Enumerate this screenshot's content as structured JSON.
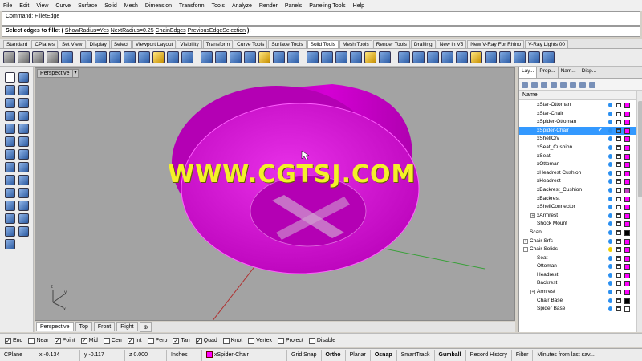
{
  "menu": [
    "File",
    "Edit",
    "View",
    "Curve",
    "Surface",
    "Solid",
    "Mesh",
    "Dimension",
    "Transform",
    "Tools",
    "Analyze",
    "Render",
    "Panels",
    "Paneling Tools",
    "Help"
  ],
  "command_history": "Command: FilletEdge",
  "command_prompt": {
    "prefix": "Select edges to fillet (",
    "opt1": "ShowRadius=Yes",
    "opt2": "NextRadius=0.25",
    "opt3": "ChainEdges",
    "opt4": "PreviousEdgeSelection",
    "suffix": "):"
  },
  "toolbar_tabs": [
    "Standard",
    "CPlanes",
    "Set View",
    "Display",
    "Select",
    "Viewport Layout",
    "Visibility",
    "Transform",
    "Curve Tools",
    "Surface Tools",
    "Solid Tools",
    "Mesh Tools",
    "Render Tools",
    "Drafting",
    "New in V5",
    "New V-Ray For Rhino",
    "V-Ray Lights 00"
  ],
  "active_toolbar_tab": "Solid Tools",
  "viewport": {
    "label": "Perspective",
    "dropdown": "▾",
    "watermark": "WWW.CGTSJ.COM",
    "object_color": "#c800c8"
  },
  "view_tabs": [
    "Perspective",
    "Top",
    "Front",
    "Right",
    "⊕"
  ],
  "osnaps": [
    {
      "label": "End",
      "checked": true
    },
    {
      "label": "Near",
      "checked": false
    },
    {
      "label": "Point",
      "checked": true
    },
    {
      "label": "Mid",
      "checked": true
    },
    {
      "label": "Cen",
      "checked": false
    },
    {
      "label": "Int",
      "checked": true
    },
    {
      "label": "Perp",
      "checked": false
    },
    {
      "label": "Tan",
      "checked": true
    },
    {
      "label": "Quad",
      "checked": true
    },
    {
      "label": "Knot",
      "checked": false
    },
    {
      "label": "Vertex",
      "checked": false
    },
    {
      "label": "Project",
      "checked": false
    },
    {
      "label": "Disable",
      "checked": false
    }
  ],
  "status": {
    "cplane": "CPlane",
    "x": "x -0.134",
    "y": "y -0.117",
    "z": "z 0.000",
    "units": "Inches",
    "layer": "xSpider-Chair",
    "grid_snap": "Grid Snap",
    "ortho": "Ortho",
    "planar": "Planar",
    "osnap": "Osnap",
    "smarttrack": "SmartTrack",
    "gumball": "Gumball",
    "record_history": "Record History",
    "filter": "Filter",
    "minutes": "Minutes from last sav..."
  },
  "panel": {
    "tabs": [
      "Lay...",
      "Prop...",
      "Nam...",
      "Disp..."
    ],
    "header": "Name",
    "layers": [
      {
        "name": "xStar-Ottoman",
        "indent": 2,
        "color": "#ff00ff",
        "selected": false,
        "expand": ""
      },
      {
        "name": "xStar-Chair",
        "indent": 2,
        "color": "#ff00ff",
        "selected": false,
        "expand": ""
      },
      {
        "name": "xSpider-Ottoman",
        "indent": 2,
        "color": "#ff00ff",
        "selected": false,
        "expand": ""
      },
      {
        "name": "xSpider-Chair",
        "indent": 2,
        "color": "#ff00ff",
        "selected": true,
        "expand": "",
        "current": true
      },
      {
        "name": "xShellCrv",
        "indent": 2,
        "color": "#ff00ff",
        "selected": false,
        "expand": ""
      },
      {
        "name": "xSeat_Cushion",
        "indent": 2,
        "color": "#ff00ff",
        "selected": false,
        "expand": ""
      },
      {
        "name": "xSeat",
        "indent": 2,
        "color": "#ff00ff",
        "selected": false,
        "expand": ""
      },
      {
        "name": "xOttoman",
        "indent": 2,
        "color": "#ff00ff",
        "selected": false,
        "expand": ""
      },
      {
        "name": "xHeadrest Cushion",
        "indent": 2,
        "color": "#ff00ff",
        "selected": false,
        "expand": ""
      },
      {
        "name": "xHeadrest",
        "indent": 2,
        "color": "#ff00ff",
        "selected": false,
        "expand": ""
      },
      {
        "name": "xBackrest_Cushion",
        "indent": 2,
        "color": "#c040c0",
        "selected": false,
        "expand": ""
      },
      {
        "name": "xBackrest",
        "indent": 2,
        "color": "#ff00ff",
        "selected": false,
        "expand": ""
      },
      {
        "name": "xShellConnector",
        "indent": 2,
        "color": "#ff00ff",
        "selected": false,
        "expand": ""
      },
      {
        "name": "xArmrest",
        "indent": 2,
        "color": "#ff00ff",
        "selected": false,
        "expand": "+"
      },
      {
        "name": "Shock Mount",
        "indent": 2,
        "color": "#ff00ff",
        "selected": false,
        "expand": ""
      },
      {
        "name": "Scan",
        "indent": 1,
        "color": "#000000",
        "selected": false,
        "expand": ""
      },
      {
        "name": "Chair Srfs",
        "indent": 1,
        "color": "#ff00ff",
        "selected": false,
        "expand": "+"
      },
      {
        "name": "Chair Solids",
        "indent": 1,
        "color": "#ff00ff",
        "selected": false,
        "expand": "-",
        "bulb": "yellow"
      },
      {
        "name": "Seat",
        "indent": 2,
        "color": "#ff00ff",
        "selected": false,
        "expand": ""
      },
      {
        "name": "Ottoman",
        "indent": 2,
        "color": "#ff00ff",
        "selected": false,
        "expand": ""
      },
      {
        "name": "Headrest",
        "indent": 2,
        "color": "#ff00ff",
        "selected": false,
        "expand": ""
      },
      {
        "name": "Backrest",
        "indent": 2,
        "color": "#ff00ff",
        "selected": false,
        "expand": ""
      },
      {
        "name": "Armrest",
        "indent": 2,
        "color": "#ff00ff",
        "selected": false,
        "expand": "+"
      },
      {
        "name": "Chair Base",
        "indent": 2,
        "color": "#000000",
        "selected": false,
        "expand": ""
      },
      {
        "name": "Spider Base",
        "indent": 2,
        "color": "#ffffff",
        "selected": false,
        "expand": ""
      }
    ]
  }
}
